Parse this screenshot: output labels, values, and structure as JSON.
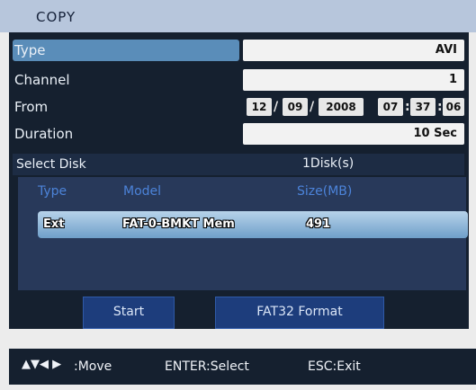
{
  "title": "COPY",
  "settings": {
    "type": {
      "label": "Type",
      "value": "AVI"
    },
    "channel": {
      "label": "Channel",
      "value": "1"
    },
    "from": {
      "label": "From",
      "month": "12",
      "day": "09",
      "year": "2008",
      "hour": "07",
      "minute": "37",
      "second": "06",
      "date_sep": "/",
      "time_sep": ":"
    },
    "duration": {
      "label": "Duration",
      "value": "10 Sec"
    }
  },
  "select_disk": {
    "label": "Select Disk",
    "count": "1Disk(s)"
  },
  "disk_table": {
    "headers": {
      "type": "Type",
      "model": "Model",
      "size": "Size(MB)"
    },
    "rows": [
      {
        "type": "Ext",
        "model": "FAT-0-BMKT Mem",
        "size": "491"
      }
    ]
  },
  "buttons": {
    "start": "Start",
    "format": "FAT32 Format"
  },
  "help": {
    "arrows": "▲▼◀ ▶",
    "move": ":Move",
    "enter": "ENTER:Select",
    "esc": "ESC:Exit"
  },
  "colors": {
    "panel_bg": "#15202f",
    "selected_row": "#5a8db9",
    "title_bar": "#b7c6dc",
    "column_header": "#4c83d9",
    "button_bg": "#1d3d7c"
  }
}
